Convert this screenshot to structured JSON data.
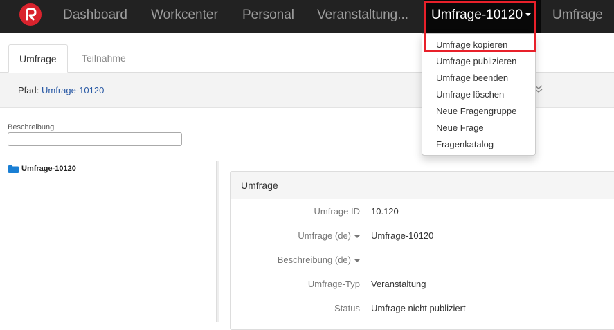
{
  "navbar": {
    "items": [
      "Dashboard",
      "Workcenter",
      "Personal",
      "Veranstaltung...",
      "Umfrage"
    ],
    "active": "Umfrage-10120"
  },
  "dropdown": {
    "items": [
      "Umfrage kopieren",
      "Umfrage publizieren",
      "Umfrage beenden",
      "Umfrage löschen",
      "Neue Fragengruppe",
      "Neue Frage",
      "Fragenkatalog"
    ]
  },
  "tabs": {
    "active": "Umfrage",
    "inactive": "Teilnahme"
  },
  "path": {
    "label": "Pfad:",
    "link": "Umfrage-10120"
  },
  "filter": {
    "label": "Beschreibung",
    "value": ""
  },
  "tree": {
    "root": "Umfrage-10120"
  },
  "panel": {
    "heading": "Umfrage",
    "rows": [
      {
        "label": "Umfrage ID",
        "value": "10.120"
      },
      {
        "label": "Umfrage (de)",
        "value": "Umfrage-10120"
      },
      {
        "label": "Beschreibung (de)",
        "value": ""
      },
      {
        "label": "Umfrage-Typ",
        "value": "Veranstaltung"
      },
      {
        "label": "Status",
        "value": "Umfrage nicht publiziert"
      }
    ]
  },
  "colors": {
    "navbar": "#222222",
    "active_nav": "#080808",
    "highlight": "#e8202a",
    "link": "#2a5aa5",
    "folder": "#1a7fd4",
    "logo": "#d9232d"
  }
}
